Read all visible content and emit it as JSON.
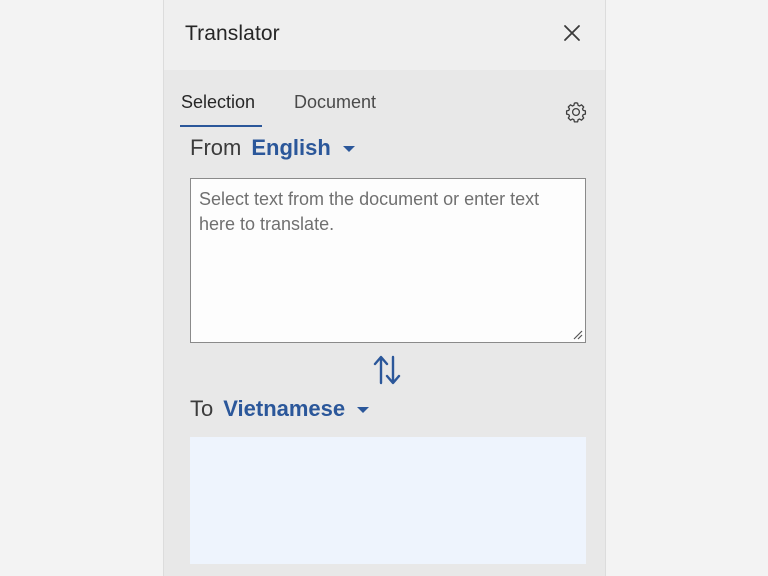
{
  "pane": {
    "title": "Translator"
  },
  "tabs": [
    {
      "label": "Selection",
      "selected": true
    },
    {
      "label": "Document",
      "selected": false
    }
  ],
  "from": {
    "label": "From",
    "language": "English"
  },
  "source": {
    "placeholder": "Select text from the document or enter text here to translate."
  },
  "to": {
    "label": "To",
    "language": "Vietnamese"
  },
  "icons": {
    "close": "close-icon",
    "settings": "gear-icon",
    "swap": "swap-arrows-icon"
  },
  "colors": {
    "accent": "#2b579a",
    "target_background": "#eef4fd"
  }
}
